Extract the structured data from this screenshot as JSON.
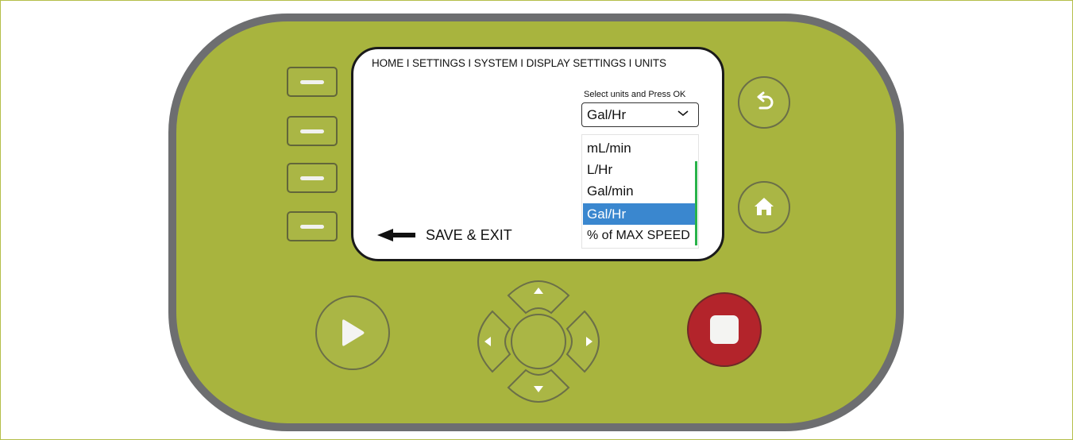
{
  "screen": {
    "breadcrumb": "HOME I SETTINGS I SYSTEM I DISPLAY SETTINGS I UNITS",
    "select_prompt": "Select units and Press OK",
    "selected_unit": "Gal/Hr",
    "unit_options": [
      "mL/min",
      "L/Hr",
      "Gal/min",
      "Gal/Hr",
      "% of MAX SPEED"
    ],
    "highlighted_option": "Gal/Hr",
    "save_exit_label": "SAVE & EXIT"
  },
  "icons": {
    "back": "back-arrow-icon",
    "home": "home-icon",
    "play": "play-icon",
    "stop": "stop-icon",
    "up": "arrow-up-icon",
    "down": "arrow-down-icon",
    "left": "arrow-left-icon",
    "right": "arrow-right-icon",
    "chevron": "chevron-down-icon",
    "save_arrow": "arrow-left-icon"
  },
  "colors": {
    "device_body": "#a8b43e",
    "device_rim": "#6d6e70",
    "highlight": "#3a87cf",
    "scrollbar": "#29b34a",
    "stop_button": "#b3242b"
  }
}
